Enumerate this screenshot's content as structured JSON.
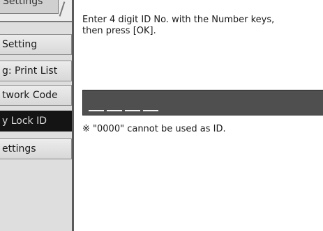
{
  "sidebar": {
    "top_tab_label": "Settings",
    "items": [
      {
        "label": "Setting",
        "selected": false
      },
      {
        "label": "g: Print List",
        "selected": false
      },
      {
        "label": "twork Code",
        "selected": false
      },
      {
        "label": "y Lock ID",
        "selected": true
      },
      {
        "label": "ettings",
        "selected": false
      }
    ]
  },
  "content": {
    "instruction": "Enter 4 digit ID No. with the Number keys,\nthen press [OK].",
    "id_digits_count": 4,
    "note": "※ \"0000\" cannot be used as ID."
  },
  "colors": {
    "sidebar_bg": "#dedede",
    "selected_bg": "#141414",
    "input_bg": "#4f4f4f"
  }
}
